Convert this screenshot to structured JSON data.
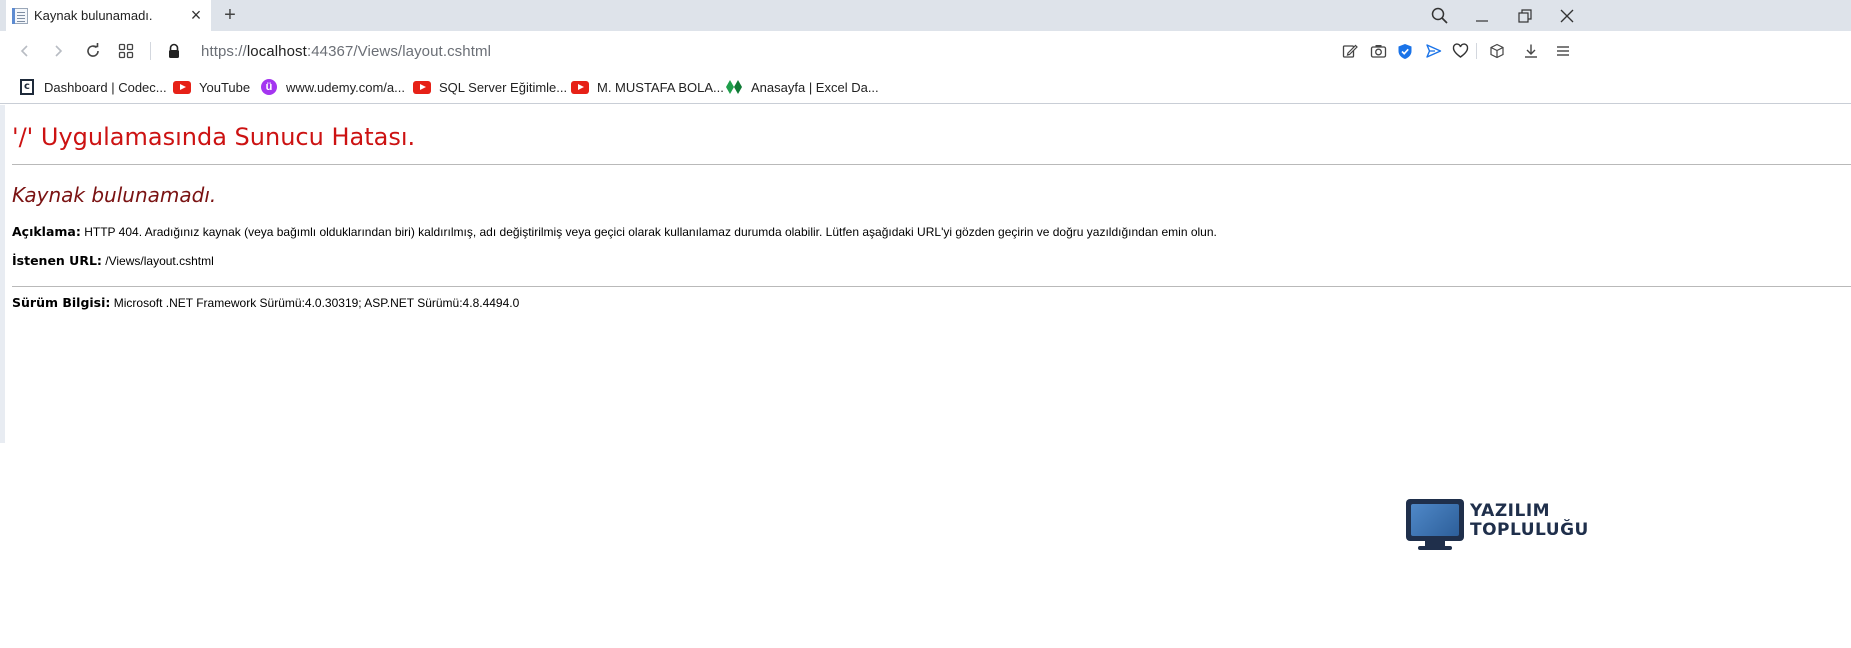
{
  "browser": {
    "tab": {
      "title": "Kaynak bulunamadı."
    },
    "address_bar": {
      "scheme": "https://",
      "host": "localhost",
      "rest": ":44367/Views/layout.cshtml"
    },
    "bookmarks": [
      {
        "label": "Dashboard | Codec...",
        "icon": "codecademy-icon"
      },
      {
        "label": "YouTube",
        "icon": "youtube-icon"
      },
      {
        "label": "www.udemy.com/a...",
        "icon": "udemy-icon"
      },
      {
        "label": "SQL Server Eğitimle...",
        "icon": "youtube-icon"
      },
      {
        "label": "M. MUSTAFA BOLA...",
        "icon": "youtube-icon"
      },
      {
        "label": "Anasayfa | Excel Da...",
        "icon": "excel-leaf-icon"
      }
    ]
  },
  "page": {
    "heading": "'/' Uygulamasında Sunucu Hatası.",
    "subheading": "Kaynak bulunamadı.",
    "description_label": "Açıklama:",
    "description_text": "HTTP 404. Aradığınız kaynak (veya bağımlı olduklarından biri) kaldırılmış, adı değiştirilmiş veya geçici olarak kullanılamaz durumda olabilir. Lütfen aşağıdaki URL'yi gözden geçirin ve doğru yazıldığından emin olun.",
    "requested_url_label": "İstenen URL:",
    "requested_url": "/Views/layout.cshtml",
    "version_label": "Sürüm Bilgisi:",
    "version_text": "Microsoft .NET Framework Sürümü:4.0.30319; ASP.NET Sürümü:4.8.4494.0"
  },
  "watermark": {
    "line1": "YAZILIM",
    "line2": "TOPLULUĞU"
  },
  "colors": {
    "heading": "#cc1212",
    "subheading": "#7a1212",
    "tabstrip": "#dee3ea",
    "accent_blue": "#1a73e8"
  }
}
